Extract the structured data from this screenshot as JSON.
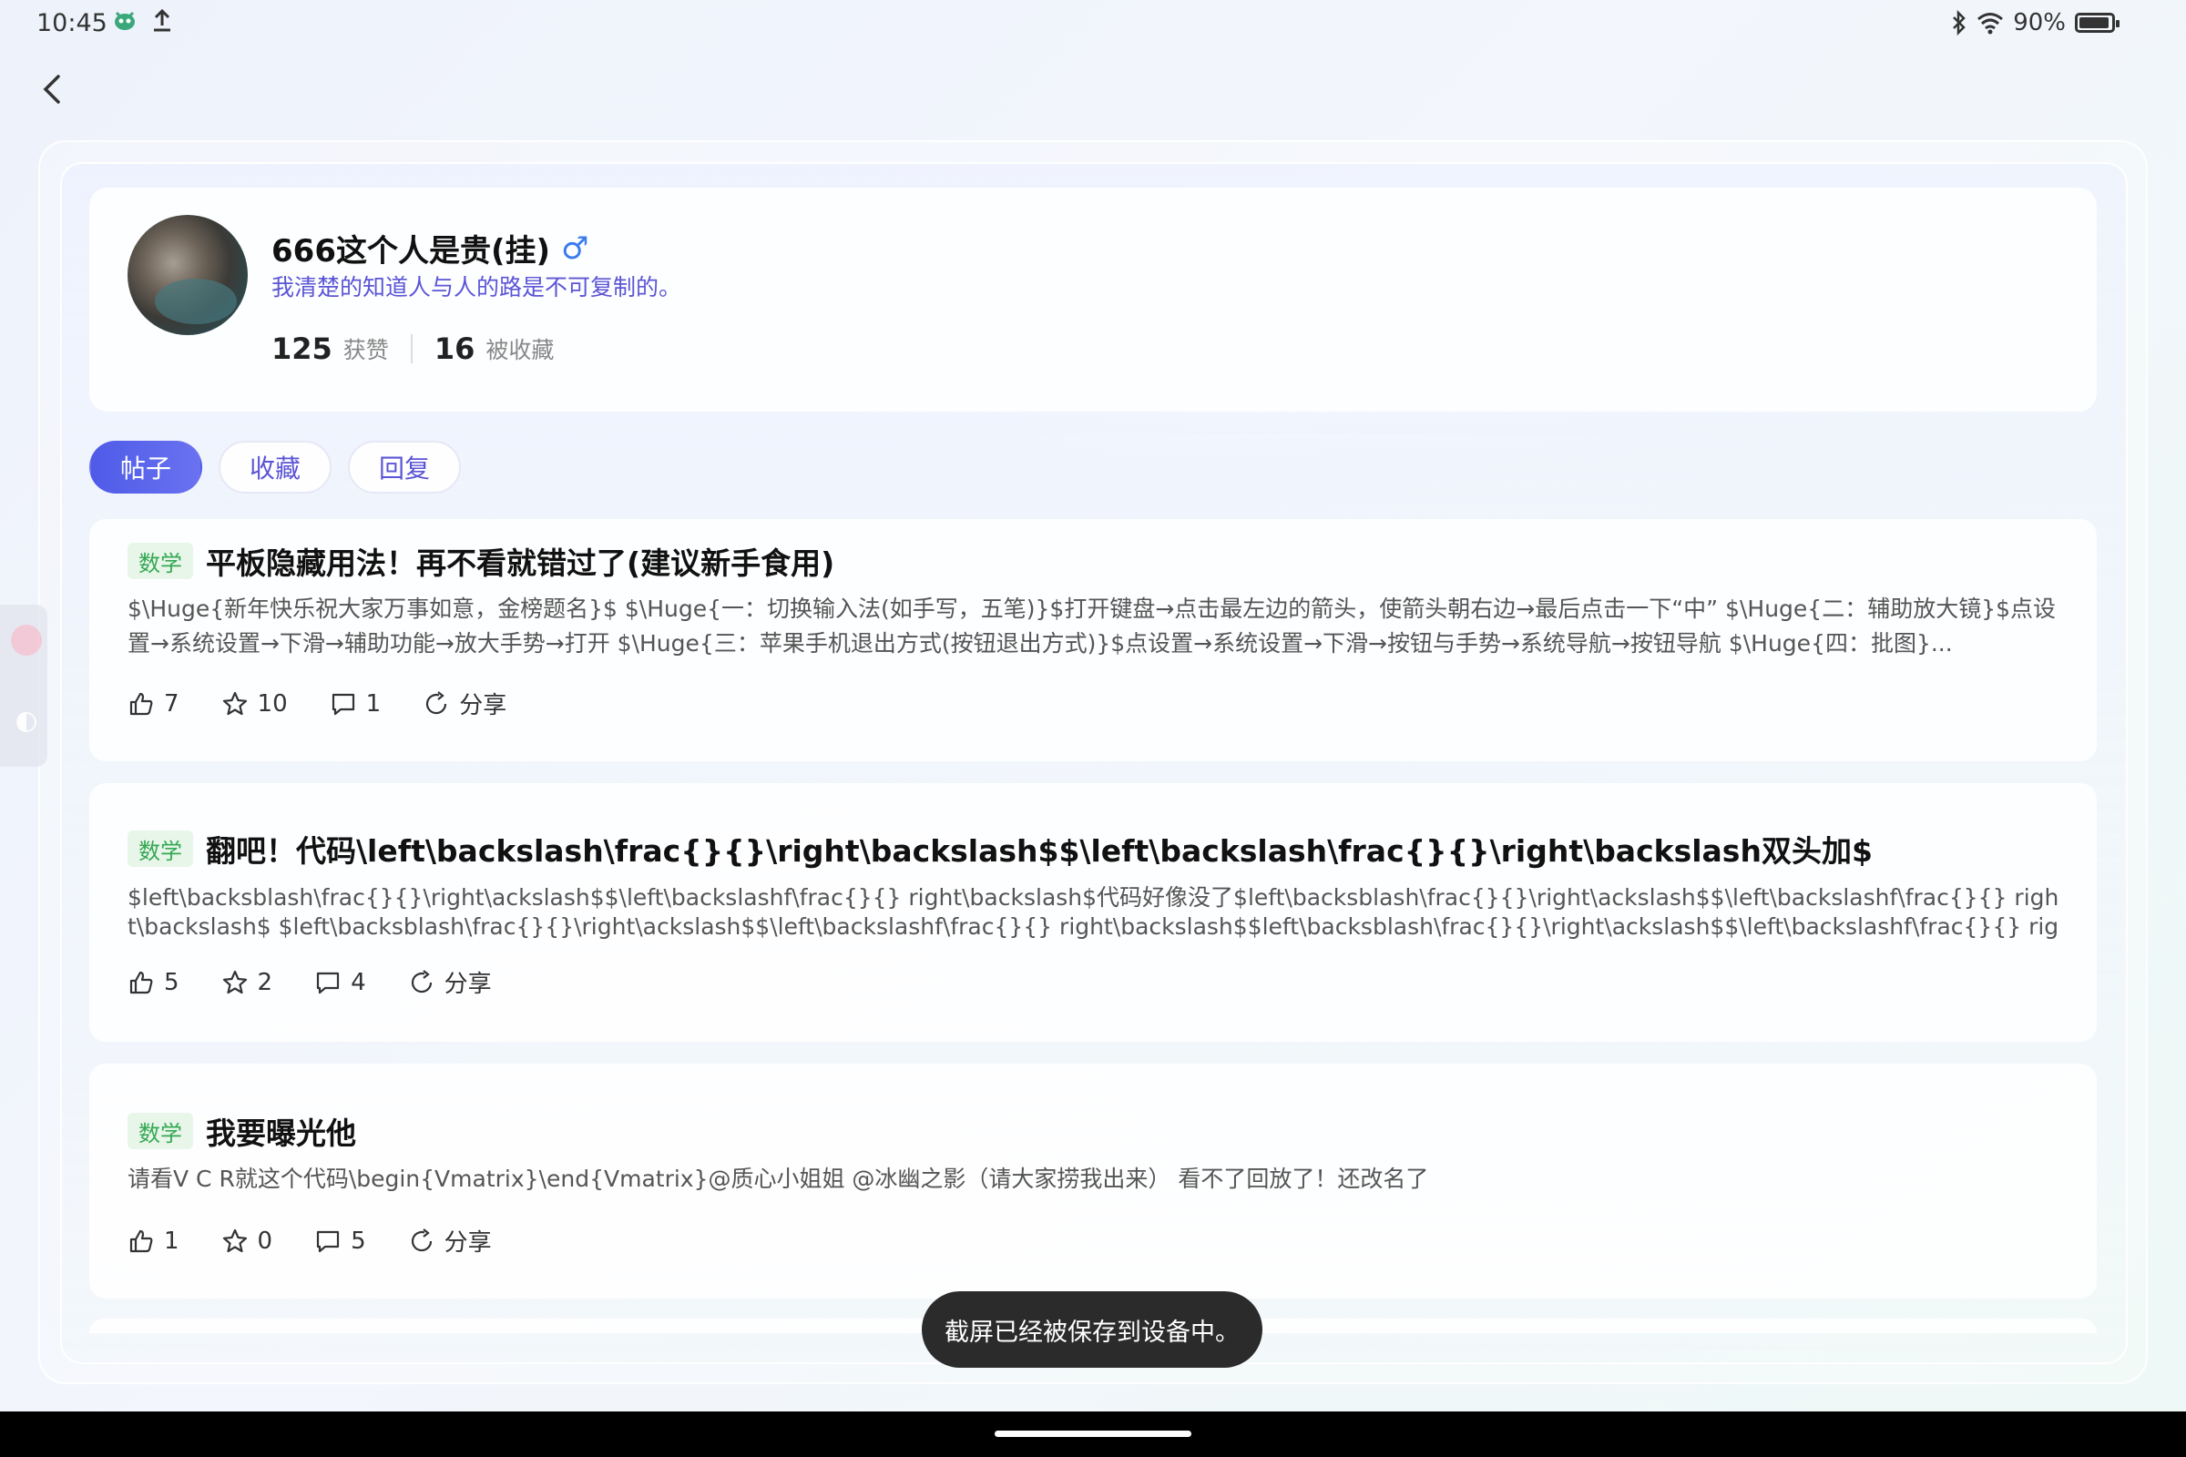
{
  "status_bar": {
    "time": "10:45",
    "left_icons": [
      "bug-icon",
      "upload-icon"
    ],
    "battery_text": "90%",
    "right_icons": [
      "bluetooth-icon",
      "wifi-icon",
      "battery-icon"
    ]
  },
  "profile": {
    "name": "666这个人是贵(挂)",
    "gender_symbol": "♂",
    "bio": "我清楚的知道人与人的路是不可复制的。",
    "likes_count": "125",
    "likes_label": "获赞",
    "favorited_count": "16",
    "favorited_label": "被收藏"
  },
  "tabs": [
    {
      "label": "帖子",
      "active": true
    },
    {
      "label": "收藏",
      "active": false
    },
    {
      "label": "回复",
      "active": false
    }
  ],
  "posts": [
    {
      "tag": "数学",
      "title": "平板隐藏用法！再不看就错过了(建议新手食用)",
      "body": "$\\Huge{新年快乐祝大家万事如意，金榜题名}$  $\\Huge{一：切换输入法(如手写，五笔)}$打开键盘→点击最左边的箭头，使箭头朝右边→最后点击一下“中” $\\Huge{二：辅助放大镜}$点设置→系统设置→下滑→辅助功能→放大手势→打开  $\\Huge{三：苹果手机退出方式(按钮退出方式)}$点设置→系统设置→下滑→按钮与手势→系统导航→按钮导航 $\\Huge{四：批图}...",
      "likes": "7",
      "stars": "10",
      "comments": "1",
      "share": "分享"
    },
    {
      "tag": "数学",
      "title": "翻吧！代码\\left\\backslash\\frac{}{}\\right\\backslash$$\\left\\backslash\\frac{}{}\\right\\backslash双头加$",
      "body": "$left\\backsblash\\frac{}{}\\right\\ackslash$$\\left\\backslashf\\frac{}{} right\\backslash$代码好像没了$left\\backsblash\\frac{}{}\\right\\ackslash$$\\left\\backslashf\\frac{}{} right\\backslash$ $left\\backsblash\\frac{}{}\\right\\ackslash$$\\left\\backslashf\\frac{}{} right\\backslash$$left\\backsblash\\frac{}{}\\right\\ackslash$$\\left\\backslashf\\frac{}{} right\\backslash$...",
      "likes": "5",
      "stars": "2",
      "comments": "4",
      "share": "分享"
    },
    {
      "tag": "数学",
      "title": "我要曝光他",
      "body": "请看V C R就这个代码\\begin{Vmatrix}\\end{Vmatrix}@质心小姐姐 @冰幽之影（请大家捞我出来） 看不了回放了！还改名了",
      "likes": "1",
      "stars": "0",
      "comments": "5",
      "share": "分享"
    }
  ],
  "toast": "截屏已经被保存到设备中。"
}
